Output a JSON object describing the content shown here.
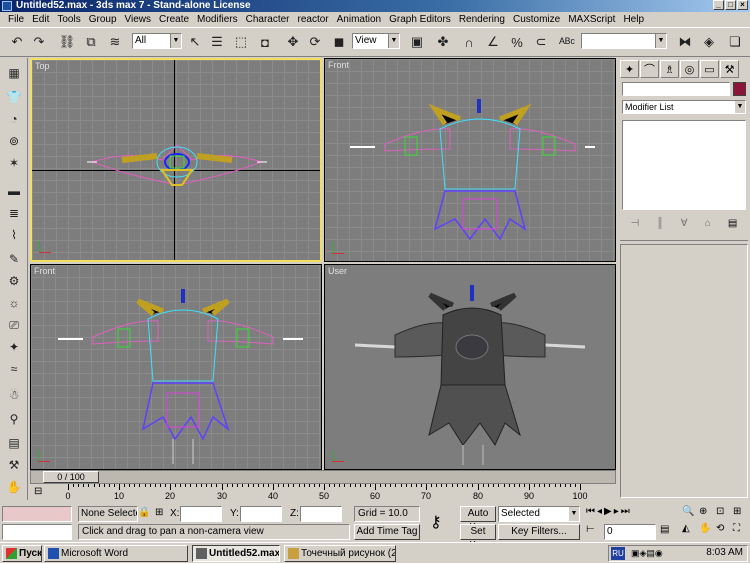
{
  "window": {
    "title": "Untitled52.max - 3ds max 7 - Stand-alone License"
  },
  "menu": [
    "File",
    "Edit",
    "Tools",
    "Group",
    "Views",
    "Create",
    "Modifiers",
    "Character",
    "reactor",
    "Animation",
    "Graph Editors",
    "Rendering",
    "Customize",
    "MAXScript",
    "Help"
  ],
  "toolbar": {
    "selection_filter": "All",
    "ref_coord": "View",
    "named_selection": ""
  },
  "viewports": [
    {
      "label": "Top"
    },
    {
      "label": "Front"
    },
    {
      "label": "Front"
    },
    {
      "label": "User"
    }
  ],
  "command_panel": {
    "object_name": "",
    "modifier_list": "Modifier List",
    "color": "#8b1538"
  },
  "time": {
    "frame_display": "0 / 100",
    "ticks": [
      "0",
      "10",
      "20",
      "30",
      "40",
      "50",
      "60",
      "70",
      "80",
      "90",
      "100"
    ]
  },
  "status": {
    "selection": "None Selecte",
    "x_label": "X:",
    "y_label": "Y:",
    "z_label": "Z:",
    "x_value": "",
    "y_value": "",
    "z_value": "",
    "grid": "Grid = 10.0",
    "prompt": "Click and drag to pan a non-camera view",
    "add_time_tag": "Add Time Tag",
    "auto_key": "Auto Key",
    "set_key": "Set Key",
    "key_mode": "Selected",
    "key_filters": "Key Filters...",
    "current_frame": "0"
  },
  "taskbar": {
    "start": "Пуск",
    "items": [
      "Microsoft Word",
      "Untitled52.max - 3ds ...",
      "Точечный рисунок (2)...."
    ],
    "lang": "RU",
    "clock": "8:03 AM"
  }
}
